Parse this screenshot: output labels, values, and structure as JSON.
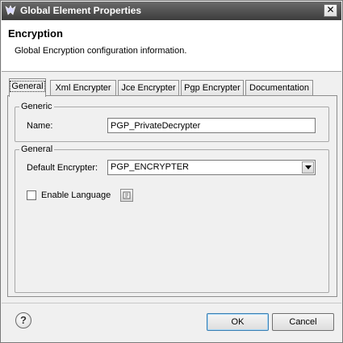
{
  "window": {
    "title": "Global Element Properties",
    "close_glyph": "✕"
  },
  "header": {
    "title": "Encryption",
    "description": "Global Encryption configuration information."
  },
  "tabs": [
    {
      "label": "General",
      "active": true
    },
    {
      "label": "Xml Encrypter",
      "active": false
    },
    {
      "label": "Jce Encrypter",
      "active": false
    },
    {
      "label": "Pgp Encrypter",
      "active": false
    },
    {
      "label": "Documentation",
      "active": false
    }
  ],
  "generic_group": {
    "legend": "Generic",
    "name_label": "Name:",
    "name_value": "PGP_PrivateDecrypter"
  },
  "general_group": {
    "legend": "General",
    "default_encrypter_label": "Default Encrypter:",
    "default_encrypter_value": "PGP_ENCRYPTER",
    "enable_language_label": "Enable Language",
    "enable_language_checked": false
  },
  "footer": {
    "help_glyph": "?",
    "ok_label": "OK",
    "cancel_label": "Cancel"
  },
  "colors": {
    "titlebar": "#4a4a4a",
    "dialog_bg": "#f0f0f0",
    "default_button_border": "#3c7fb1"
  }
}
